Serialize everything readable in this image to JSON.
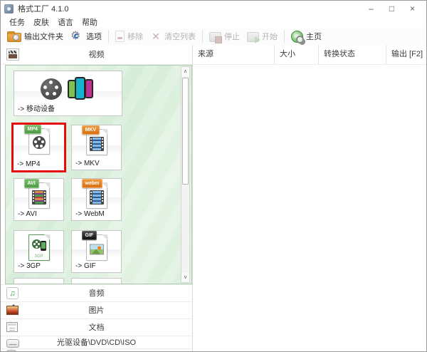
{
  "window": {
    "title": "格式工厂 4.1.0",
    "controls": {
      "minimize": "–",
      "maximize": "□",
      "close": "×"
    }
  },
  "menu": {
    "items": [
      "任务",
      "皮肤",
      "语言",
      "帮助"
    ]
  },
  "toolbar": {
    "buttons": [
      {
        "label": "输出文件夹",
        "icon": "output-folder-icon",
        "enabled": true
      },
      {
        "label": "选项",
        "icon": "options-gear-icon",
        "enabled": true
      },
      {
        "label": "移除",
        "icon": "remove-item-icon",
        "enabled": false
      },
      {
        "label": "清空列表",
        "icon": "clear-list-icon",
        "enabled": false
      },
      {
        "label": "停止",
        "icon": "stop-icon",
        "enabled": false
      },
      {
        "label": "开始",
        "icon": "start-icon",
        "enabled": false
      },
      {
        "label": "主页",
        "icon": "home-globe-icon",
        "enabled": true
      }
    ]
  },
  "sidebar": {
    "active_tab": {
      "label": "视频",
      "icon": "video-clapperboard-icon"
    },
    "video_formats": [
      {
        "label": "-> 移动设备",
        "icon": "mobile-devices-icon",
        "highlighted": false
      },
      {
        "label": "-> MP4",
        "icon": "mp4-file-icon",
        "tag": "MP4",
        "highlighted": true
      },
      {
        "label": "-> MKV",
        "icon": "mkv-file-icon",
        "tag": "MKV",
        "highlighted": false
      },
      {
        "label": "-> AVI",
        "icon": "avi-file-icon",
        "tag": "AVI",
        "highlighted": false
      },
      {
        "label": "-> WebM",
        "icon": "webm-file-icon",
        "tag": "webm",
        "highlighted": false
      },
      {
        "label": "-> 3GP",
        "icon": "3gp-file-icon",
        "tag": "3GP",
        "highlighted": false
      },
      {
        "label": "-> GIF",
        "icon": "gif-file-icon",
        "tag": "GIF",
        "highlighted": false
      }
    ],
    "tabs": [
      {
        "label": "音频",
        "icon": "audio-note-icon"
      },
      {
        "label": "图片",
        "icon": "picture-icon"
      },
      {
        "label": "文档",
        "icon": "document-icon"
      },
      {
        "label": "光驱设备\\DVD\\CD\\ISO",
        "icon": "optical-drive-icon"
      }
    ]
  },
  "list": {
    "columns": [
      "来源",
      "大小",
      "转换状态",
      "输出 [F2]"
    ]
  },
  "colors": {
    "highlight_red": "#e60c0c",
    "panel_green": "#dcf0de",
    "tag_green": "#55a050",
    "tag_orange": "#df7b1f",
    "tag_black": "#1d1d1d",
    "disabled_text": "#b4b4b4"
  }
}
